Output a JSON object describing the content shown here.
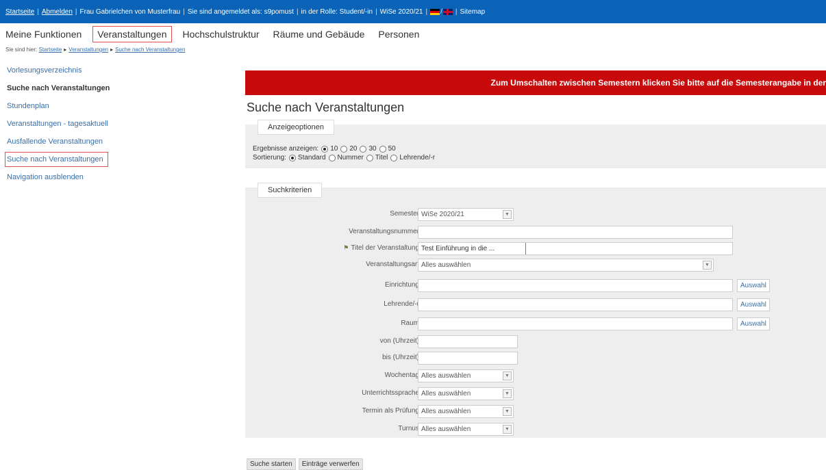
{
  "topbar": {
    "items": [
      "Startseite",
      "Abmelden",
      "Frau Gabrielchen von Musterfrau",
      "Sie sind angemeldet als: s9pomust",
      "in der Rolle: Student/-in",
      "WiSe 2020/21",
      "Sitemap"
    ],
    "lang_icons": [
      "de-flag-icon",
      "gb-flag-icon"
    ],
    "color": "#0a63b6"
  },
  "nav": {
    "items": [
      "Meine Funktionen",
      "Veranstaltungen",
      "Hochschulstruktur",
      "Räume und Gebäude",
      "Personen"
    ]
  },
  "breadcrumb": {
    "prefix": "Sie sind hier:",
    "items": [
      "Startseite",
      "Veranstaltungen",
      "Suche nach Veranstaltungen"
    ]
  },
  "sidebar": {
    "items": [
      "Vorlesungsverzeichnis",
      "Suche nach Veranstaltungen",
      "Stundenplan",
      "Veranstaltungen - tagesaktuell",
      "Ausfallende Veranstaltungen",
      "Suche nach Veranstaltungen",
      "Navigation ausblenden"
    ]
  },
  "banner": {
    "text": "Zum Umschalten zwischen Semestern klicken Sie bitte auf die Semesterangabe in der",
    "color": "#c90a0a"
  },
  "page_title": "Suche nach Veranstaltungen",
  "options": {
    "legend": "Anzeigeoptionen",
    "results_label": "Ergebnisse anzeigen:",
    "results": [
      "10",
      "20",
      "30",
      "50"
    ],
    "results_selected": "10",
    "sort_label": "Sortierung:",
    "sort": [
      "Standard",
      "Nummer",
      "Titel",
      "Lehrende/-r"
    ],
    "sort_selected": "Standard"
  },
  "criteria": {
    "legend": "Suchkriterien",
    "semester": {
      "label": "Semester",
      "value": "WiSe 2020/21"
    },
    "veranstaltungsnummer": {
      "label": "Veranstaltungsnummer",
      "value": ""
    },
    "titel": {
      "label": "Titel der Veranstaltung",
      "value": "Test Einführung in die ..."
    },
    "veranstaltungsart": {
      "label": "Veranstaltungsart",
      "value": "Alles auswählen"
    },
    "einrichtung": {
      "label": "Einrichtung",
      "value": "",
      "button": "Auswahl"
    },
    "lehrende": {
      "label": "Lehrende/-r",
      "value": "",
      "button": "Auswahl"
    },
    "raum": {
      "label": "Raum",
      "value": "",
      "button": "Auswahl"
    },
    "von": {
      "label": "von (Uhrzeit)",
      "value": ""
    },
    "bis": {
      "label": "bis (Uhrzeit)",
      "value": ""
    },
    "wochentag": {
      "label": "Wochentag",
      "value": "Alles auswählen"
    },
    "sprache": {
      "label": "Unterrichtssprache",
      "value": "Alles auswählen"
    },
    "pruefung": {
      "label": "Termin als Prüfung",
      "value": "Alles auswählen"
    },
    "turnus": {
      "label": "Turnus",
      "value": "Alles auswählen"
    }
  },
  "actions": {
    "search": "Suche starten",
    "reset": "Einträge verwerfen"
  }
}
